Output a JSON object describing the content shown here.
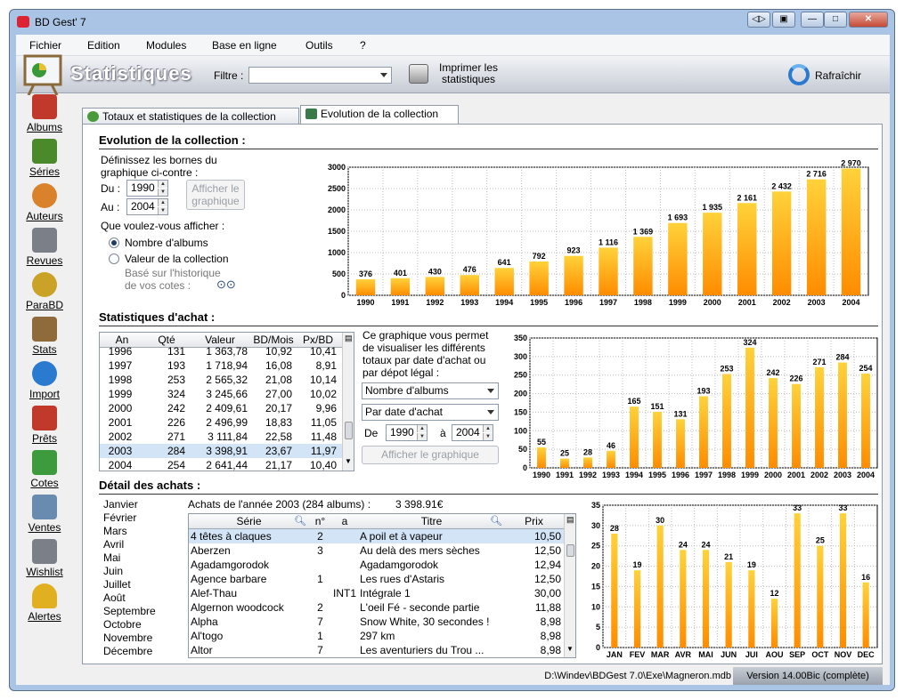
{
  "window": {
    "title": "BD Gest' 7"
  },
  "menu": [
    "Fichier",
    "Edition",
    "Modules",
    "Base en ligne",
    "Outils",
    "?"
  ],
  "header": {
    "title": "Statistiques",
    "filter_label": "Filtre :",
    "filter_value": "",
    "print_label": "Imprimer les statistiques",
    "refresh_label": "Rafraîchir"
  },
  "sidebar": [
    {
      "label": "Albums",
      "icon": "book-icon",
      "color": "#c0392b"
    },
    {
      "label": "Séries",
      "icon": "books-stack-icon",
      "color": "#4a8a2a"
    },
    {
      "label": "Auteurs",
      "icon": "people-icon",
      "color": "#d9822b"
    },
    {
      "label": "Revues",
      "icon": "magazine-icon",
      "color": "#7a7f88"
    },
    {
      "label": "ParaBD",
      "icon": "palette-icon",
      "color": "#c9a227"
    },
    {
      "label": "Stats",
      "icon": "chart-board-icon",
      "color": "#8f6a3a"
    },
    {
      "label": "Import",
      "icon": "globe-icon",
      "color": "#2a7ad0"
    },
    {
      "label": "Prêts",
      "icon": "calendar-icon",
      "color": "#c0392b"
    },
    {
      "label": "Cotes",
      "icon": "money-icon",
      "color": "#3d9a3d"
    },
    {
      "label": "Ventes",
      "icon": "cash-register-icon",
      "color": "#6a8bb0"
    },
    {
      "label": "Wishlist",
      "icon": "cart-icon",
      "color": "#7a7f88"
    },
    {
      "label": "Alertes",
      "icon": "bell-icon",
      "color": "#e0b020"
    }
  ],
  "tabs": [
    {
      "label": "Totaux et statistiques de la collection"
    },
    {
      "label": "Evolution de la collection"
    }
  ],
  "evolution": {
    "title": "Evolution de la collection :",
    "intro": [
      "Définissez les bornes du",
      "graphique ci-contre :"
    ],
    "du_label": "Du :",
    "du_value": "1990",
    "au_label": "Au :",
    "au_value": "2004",
    "show_btn": [
      "Afficher le",
      "graphique"
    ],
    "question": "Que voulez-vous afficher :",
    "opt_albums": "Nombre d'albums",
    "opt_value": "Valeur de la collection",
    "note": [
      "Basé sur l'historique",
      "de vos cotes :"
    ]
  },
  "achat": {
    "title": "Statistiques d'achat :",
    "columns": [
      "An",
      "Qté",
      "Valeur",
      "BD/Mois",
      "Px/BD"
    ],
    "rows": [
      [
        "1996",
        "131",
        "1 363,78",
        "10,92",
        "10,41"
      ],
      [
        "1997",
        "193",
        "1 718,94",
        "16,08",
        "8,91"
      ],
      [
        "1998",
        "253",
        "2 565,32",
        "21,08",
        "10,14"
      ],
      [
        "1999",
        "324",
        "3 245,66",
        "27,00",
        "10,02"
      ],
      [
        "2000",
        "242",
        "2 409,61",
        "20,17",
        "9,96"
      ],
      [
        "2001",
        "226",
        "2 496,99",
        "18,83",
        "11,05"
      ],
      [
        "2002",
        "271",
        "3 111,84",
        "22,58",
        "11,48"
      ],
      [
        "2003",
        "284",
        "3 398,91",
        "23,67",
        "11,97"
      ],
      [
        "2004",
        "254",
        "2 641,44",
        "21,17",
        "10,40"
      ]
    ],
    "selected_row": 7,
    "desc": [
      "Ce graphique vous permet",
      "de visualiser les différents",
      "totaux par date d'achat ou",
      "par dépot légal :"
    ],
    "combo1": "Nombre d'albums",
    "combo2": "Par date d'achat",
    "de_label": "De",
    "de_value": "1990",
    "a_label": "à",
    "a_value": "2004",
    "show_btn": "Afficher le graphique"
  },
  "detail": {
    "title": "Détail des achats :",
    "months": [
      "Janvier",
      "Février",
      "Mars",
      "Avril",
      "Mai",
      "Juin",
      "Juillet",
      "Août",
      "Septembre",
      "Octobre",
      "Novembre",
      "Décembre"
    ],
    "summary_label": "Achats de l'année 2003 (284 albums) :",
    "summary_value": "3 398.91€",
    "columns": [
      "Série",
      "n°",
      "a",
      "Titre",
      "Prix"
    ],
    "rows": [
      [
        "4 têtes à claques",
        "2",
        "",
        "A poil et à vapeur",
        "10,50"
      ],
      [
        "Aberzen",
        "3",
        "",
        "Au delà des mers sèches",
        "12,50"
      ],
      [
        "Agadamgorodok",
        "",
        "",
        "Agadamgorodok",
        "12,94"
      ],
      [
        "Agence barbare",
        "1",
        "",
        "Les rues d'Astaris",
        "12,50"
      ],
      [
        "Alef-Thau",
        "",
        "INT1",
        "Intégrale 1",
        "30,00"
      ],
      [
        "Algernon woodcock",
        "2",
        "",
        "L'oeil Fé - seconde partie",
        "11,88"
      ],
      [
        "Alpha",
        "7",
        "",
        "Snow White, 30 secondes !",
        "8,98"
      ],
      [
        "Al'togo",
        "1",
        "",
        "297 km",
        "8,98"
      ],
      [
        "Altor",
        "7",
        "",
        "Les aventuriers du Trou ...",
        "8,98"
      ]
    ],
    "selected_row": 0
  },
  "status": {
    "path": "D:\\Windev\\BDGest 7.0\\Exe\\Magneron.mdb",
    "version": "Version 14.00Bic (complète)"
  },
  "colors": {
    "bar_top": "#ffd23a",
    "bar_bottom": "#ff8c00",
    "selection": "#d3e4f7",
    "window_frame": "#a9c4e4"
  },
  "chart_data": [
    {
      "type": "bar",
      "categories": [
        "1990",
        "1991",
        "1992",
        "1993",
        "1994",
        "1995",
        "1996",
        "1997",
        "1998",
        "1999",
        "2000",
        "2001",
        "2002",
        "2003",
        "2004"
      ],
      "values": [
        376,
        401,
        430,
        476,
        641,
        792,
        923,
        1116,
        1369,
        1693,
        1935,
        2161,
        2432,
        2716,
        2970
      ],
      "labels": [
        "376",
        "401",
        "430",
        "476",
        "641",
        "792",
        "923",
        "1 116",
        "1 369",
        "1 693",
        "1 935",
        "2 161",
        "2 432",
        "2 716",
        "2 970"
      ],
      "yticks": [
        "0",
        "500",
        "1000",
        "1500",
        "2000",
        "2500",
        "3000"
      ],
      "ylim": [
        0,
        3000
      ],
      "grid": true
    },
    {
      "type": "bar",
      "categories": [
        "1990",
        "1991",
        "1992",
        "1993",
        "1994",
        "1995",
        "1996",
        "1997",
        "1998",
        "1999",
        "2000",
        "2001",
        "2002",
        "2003",
        "2004"
      ],
      "values": [
        55,
        25,
        28,
        46,
        165,
        151,
        131,
        193,
        253,
        324,
        242,
        226,
        271,
        284,
        254
      ],
      "labels": [
        "55",
        "25",
        "28",
        "46",
        "165",
        "151",
        "131",
        "193",
        "253",
        "324",
        "242",
        "226",
        "271",
        "284",
        "254"
      ],
      "yticks": [
        "0",
        "50",
        "100",
        "150",
        "200",
        "250",
        "300",
        "350"
      ],
      "ylim": [
        0,
        350
      ],
      "grid": true
    },
    {
      "type": "bar",
      "categories": [
        "JAN",
        "FEV",
        "MAR",
        "AVR",
        "MAI",
        "JUN",
        "JUI",
        "AOU",
        "SEP",
        "OCT",
        "NOV",
        "DEC"
      ],
      "values": [
        28,
        19,
        30,
        24,
        24,
        21,
        19,
        12,
        33,
        25,
        33,
        16
      ],
      "labels": [
        "28",
        "19",
        "30",
        "24",
        "24",
        "21",
        "19",
        "12",
        "33",
        "25",
        "33",
        "16"
      ],
      "yticks": [
        "0",
        "5",
        "10",
        "15",
        "20",
        "25",
        "30",
        "35"
      ],
      "ylim": [
        0,
        35
      ],
      "grid": true
    }
  ]
}
